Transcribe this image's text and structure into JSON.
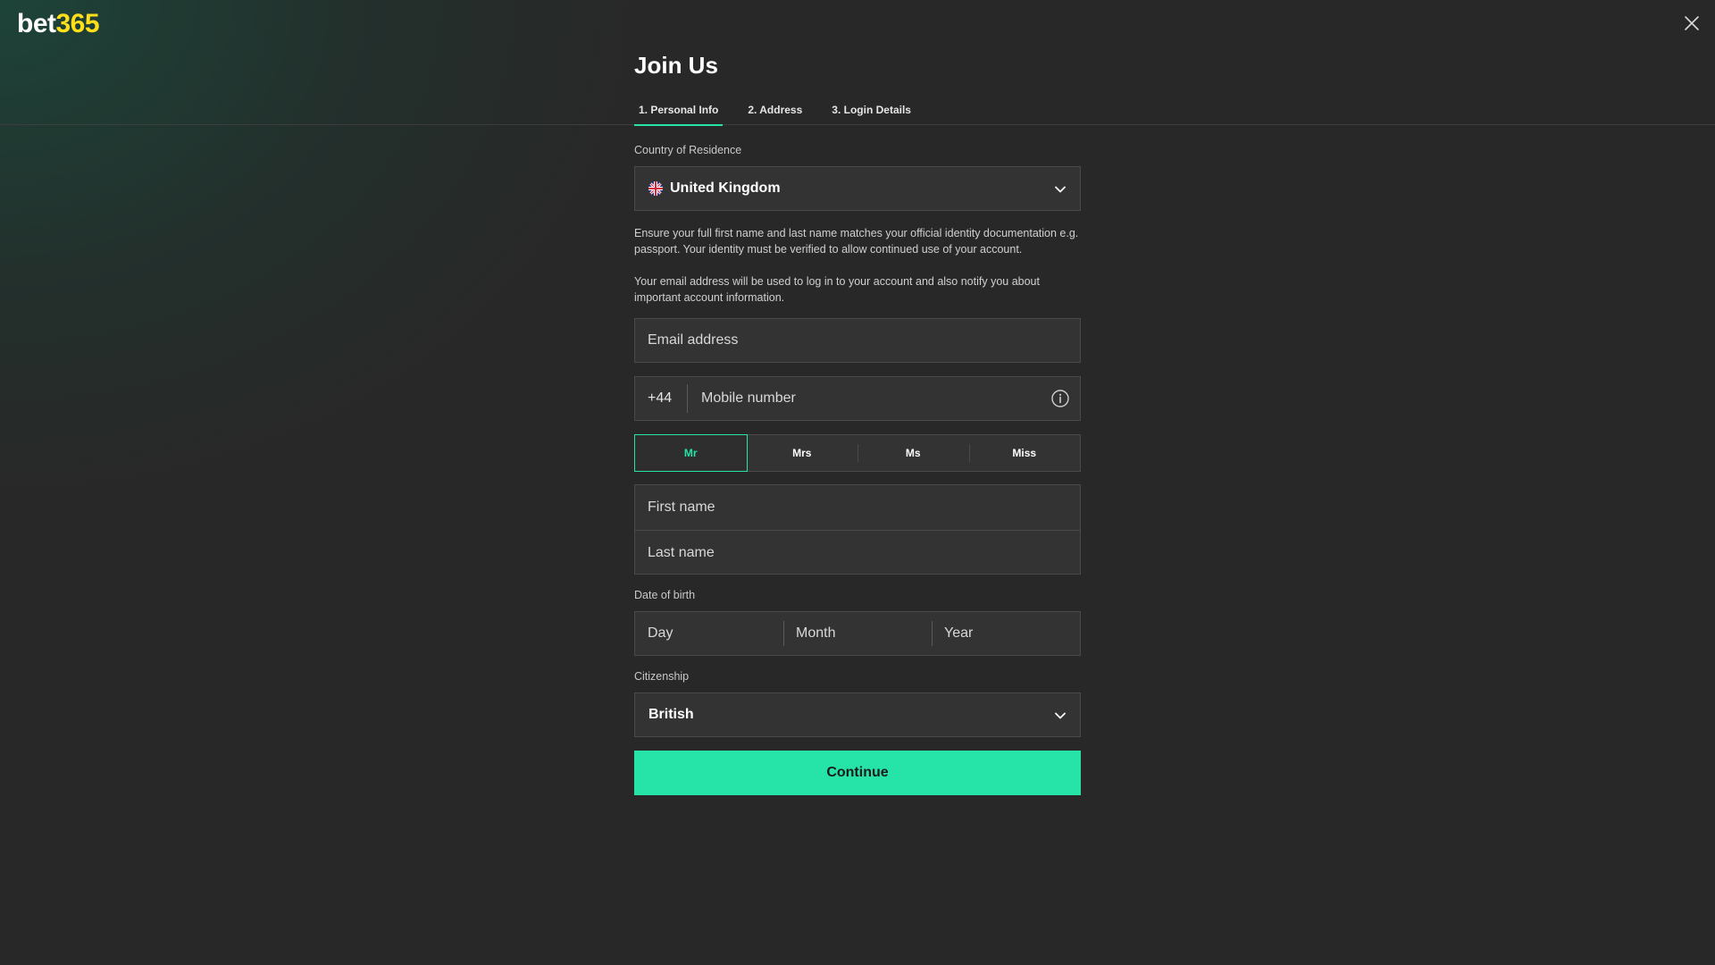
{
  "brand": {
    "logo_part1": "bet",
    "logo_part2": "365",
    "accent": "#26e3a7",
    "logo_accent": "#ffdf1b"
  },
  "header": {
    "close_icon": "close-icon"
  },
  "page": {
    "title": "Join Us"
  },
  "steps": [
    {
      "label": "1.  Personal Info",
      "active": true
    },
    {
      "label": "2.  Address",
      "active": false
    },
    {
      "label": "3.  Login Details",
      "active": false
    }
  ],
  "country": {
    "label": "Country of Residence",
    "value": "United Kingdom",
    "flag_icon": "uk-flag-icon"
  },
  "notes": {
    "identity": "Ensure your full first name and last name matches your official identity documentation e.g. passport. Your identity must be verified to allow continued use of your account.",
    "email": "Your email address will be used to log in to your account and also notify you about important account information."
  },
  "email": {
    "placeholder": "Email address",
    "value": ""
  },
  "mobile": {
    "prefix": "+44",
    "placeholder": "Mobile number",
    "value": ""
  },
  "titles": {
    "options": [
      "Mr",
      "Mrs",
      "Ms",
      "Miss"
    ],
    "selected": "Mr"
  },
  "name": {
    "first_placeholder": "First name",
    "last_placeholder": "Last name"
  },
  "dob": {
    "label": "Date of birth",
    "day_placeholder": "Day",
    "month_placeholder": "Month",
    "year_placeholder": "Year"
  },
  "citizenship": {
    "label": "Citizenship",
    "value": "British"
  },
  "actions": {
    "continue_label": "Continue"
  }
}
